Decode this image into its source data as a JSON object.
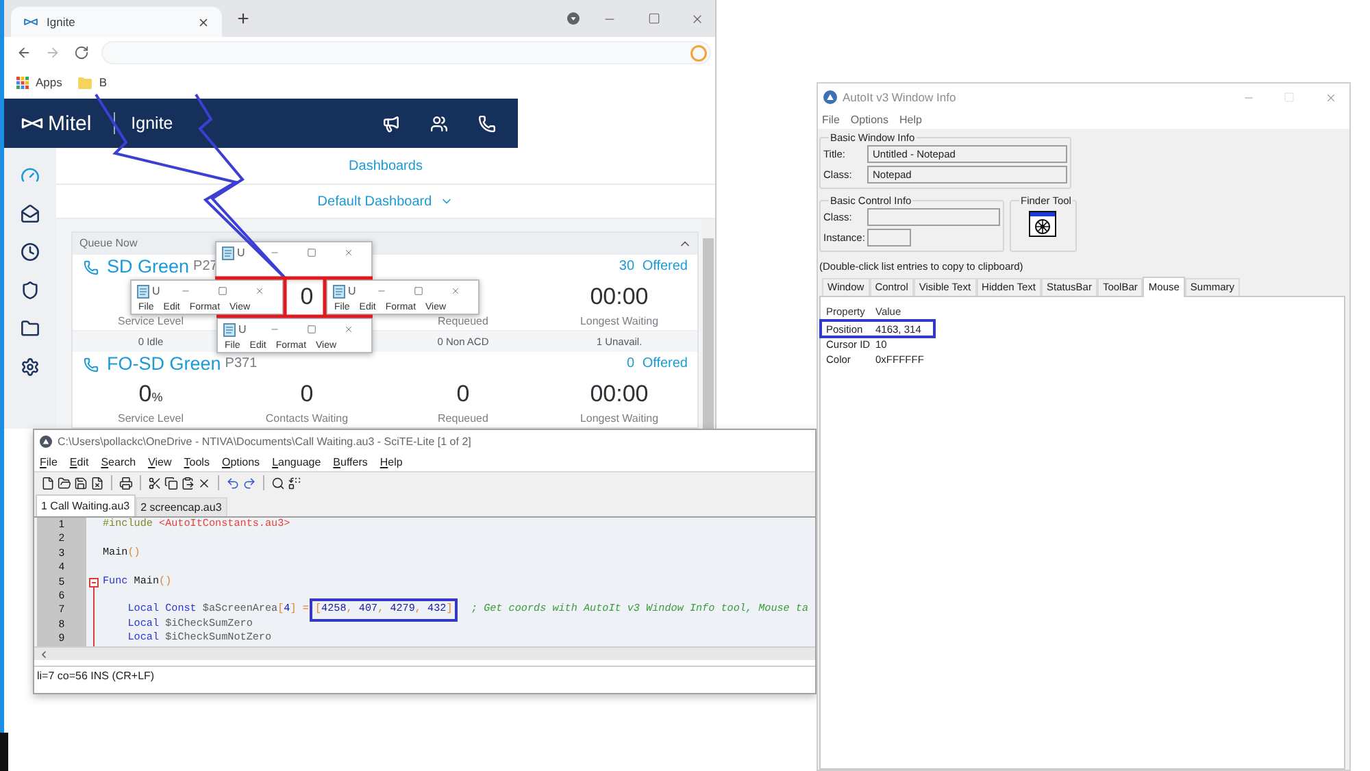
{
  "browser": {
    "tabs": [
      {
        "title": "Ignite",
        "selected": true
      }
    ],
    "bookmarks": [
      {
        "kind": "apps",
        "label": "Apps"
      },
      {
        "kind": "folder",
        "label": "B"
      }
    ],
    "app_header": {
      "brand": "Mitel",
      "product": "Ignite"
    },
    "sidebar": {
      "items": [
        {
          "kind": "dashboard",
          "selected": true
        },
        {
          "kind": "inbox",
          "selected": false
        },
        {
          "kind": "history",
          "selected": false
        },
        {
          "kind": "shield",
          "selected": false
        },
        {
          "kind": "folder",
          "selected": false
        },
        {
          "kind": "settings",
          "selected": false
        }
      ]
    },
    "page_title": "Dashboards",
    "dashboard_selector": "Default Dashboard",
    "queue_panel": {
      "title": "Queue Now",
      "expanded": true,
      "queues": [
        {
          "name": "SD Green",
          "code": "P27",
          "offered": "30 Offered",
          "metrics": [
            {
              "label": "Service Level",
              "footer": "0 Idle"
            },
            {
              "value": "0"
            },
            {
              "label": "Requeued",
              "footer": "0 Non ACD"
            },
            {
              "value": "00:00",
              "label": "Longest Waiting",
              "footer": "1 Unavail."
            }
          ]
        },
        {
          "name": "FO-SD Green",
          "code": "P371",
          "offered": "0 Offered",
          "metrics": [
            {
              "value": "0",
              "unit": "%",
              "label": "Service Level"
            },
            {
              "value": "0",
              "label": "Contacts Waiting"
            },
            {
              "value": "0",
              "label": "Requeued"
            },
            {
              "value": "00:00",
              "label": "Longest Waiting"
            }
          ]
        }
      ]
    }
  },
  "notepad_windows": [
    {
      "title": "U"
    },
    {
      "title": "U",
      "menu": [
        "File",
        "Edit",
        "Format",
        "View"
      ]
    },
    {
      "title": "U",
      "menu": [
        "File",
        "Edit",
        "Format",
        "View"
      ]
    },
    {
      "title": "U",
      "menu": [
        "File",
        "Edit",
        "Format",
        "View"
      ]
    }
  ],
  "editor_window": {
    "title": "C:\\Users\\pollackc\\OneDrive - NTIVA\\Documents\\Call Waiting.au3 - SciTE-Lite [1 of 2]",
    "menu": [
      "File",
      "Edit",
      "Search",
      "View",
      "Tools",
      "Options",
      "Language",
      "Buffers",
      "Help"
    ],
    "tabs": [
      {
        "label": "1 Call Waiting.au3",
        "selected": true
      },
      {
        "label": "2 screencap.au3",
        "selected": false
      }
    ],
    "lines": [
      {
        "number": "1",
        "kind": "plain",
        "tokens": [
          {
            "kind": "directive",
            "text": "#include "
          },
          {
            "kind": "string",
            "text": "<AutoItConstants.au3>"
          }
        ]
      },
      {
        "number": "2",
        "kind": "plain"
      },
      {
        "number": "3",
        "kind": "plain",
        "tokens": [
          {
            "kind": "plain",
            "text": "Main"
          },
          {
            "kind": "operator",
            "text": "()"
          }
        ]
      },
      {
        "number": "4",
        "kind": "plain"
      },
      {
        "number": "5",
        "kind": "fold",
        "tokens": [
          {
            "kind": "keyword",
            "text": "Func "
          },
          {
            "kind": "plain",
            "text": "Main"
          },
          {
            "kind": "operator",
            "text": "()"
          }
        ]
      },
      {
        "number": "6",
        "kind": "inner"
      },
      {
        "number": "7",
        "kind": "inner",
        "tokens": [
          {
            "kind": "keyword",
            "text": "    Local ",
            "highlighted": false
          },
          {
            "kind": "keyword",
            "text": "Const ",
            "highlighted": false
          },
          {
            "kind": "variable",
            "text": "$aScreenArea",
            "highlighted": false
          },
          {
            "kind": "operator",
            "text": "[",
            "highlighted": false
          },
          {
            "kind": "number",
            "text": "4",
            "highlighted": false
          },
          {
            "kind": "operator",
            "text": "] = ",
            "highlighted": false
          },
          {
            "kind": "array",
            "text": "[4258, 407, 4279, 432]",
            "highlighted": true
          },
          {
            "kind": "comment",
            "text": "   ; Get coords with AutoIt v3 Window Info tool, Mouse ta",
            "highlighted": false
          }
        ]
      },
      {
        "number": "8",
        "kind": "inner",
        "tokens": [
          {
            "kind": "keyword",
            "text": "    Local "
          },
          {
            "kind": "variable",
            "text": "$iCheckSumZero"
          }
        ]
      },
      {
        "number": "9",
        "kind": "inner",
        "tokens": [
          {
            "kind": "keyword",
            "text": "    Local "
          },
          {
            "kind": "variable",
            "text": "$iCheckSumNotZero"
          }
        ]
      }
    ],
    "status_bar": "li=7 co=56 INS (CR+LF)"
  },
  "info_window": {
    "title": "AutoIt v3 Window Info",
    "menu": [
      "File",
      "Options",
      "Help"
    ],
    "groups": [
      {
        "title": "Basic Window Info",
        "fields": [
          {
            "label": "Title:",
            "value": "Untitled - Notepad"
          },
          {
            "label": "Class:",
            "value": "Notepad"
          }
        ]
      },
      {
        "title": "Basic Control Info",
        "fields": [
          {
            "label": "Class:"
          },
          {
            "label": "Instance:"
          }
        ]
      },
      {
        "title": "Finder Tool"
      }
    ],
    "hint": "(Double-click list entries to copy to clipboard)",
    "tabs": [
      {
        "label": "Window",
        "selected": false
      },
      {
        "label": "Control",
        "selected": false
      },
      {
        "label": "Visible Text",
        "selected": false
      },
      {
        "label": "Hidden Text",
        "selected": false
      },
      {
        "label": "StatusBar",
        "selected": false
      },
      {
        "label": "ToolBar",
        "selected": false
      },
      {
        "label": "Mouse",
        "selected": true
      },
      {
        "label": "Summary",
        "selected": false
      }
    ],
    "columns": [
      "Property",
      "Value"
    ],
    "rows": [
      {
        "property": "Position",
        "value": "4163, 314",
        "highlighted": true
      },
      {
        "property": "Cursor ID",
        "value": "10",
        "highlighted": false
      },
      {
        "property": "Color",
        "value": "0xFFFFFF",
        "highlighted": false
      }
    ]
  }
}
